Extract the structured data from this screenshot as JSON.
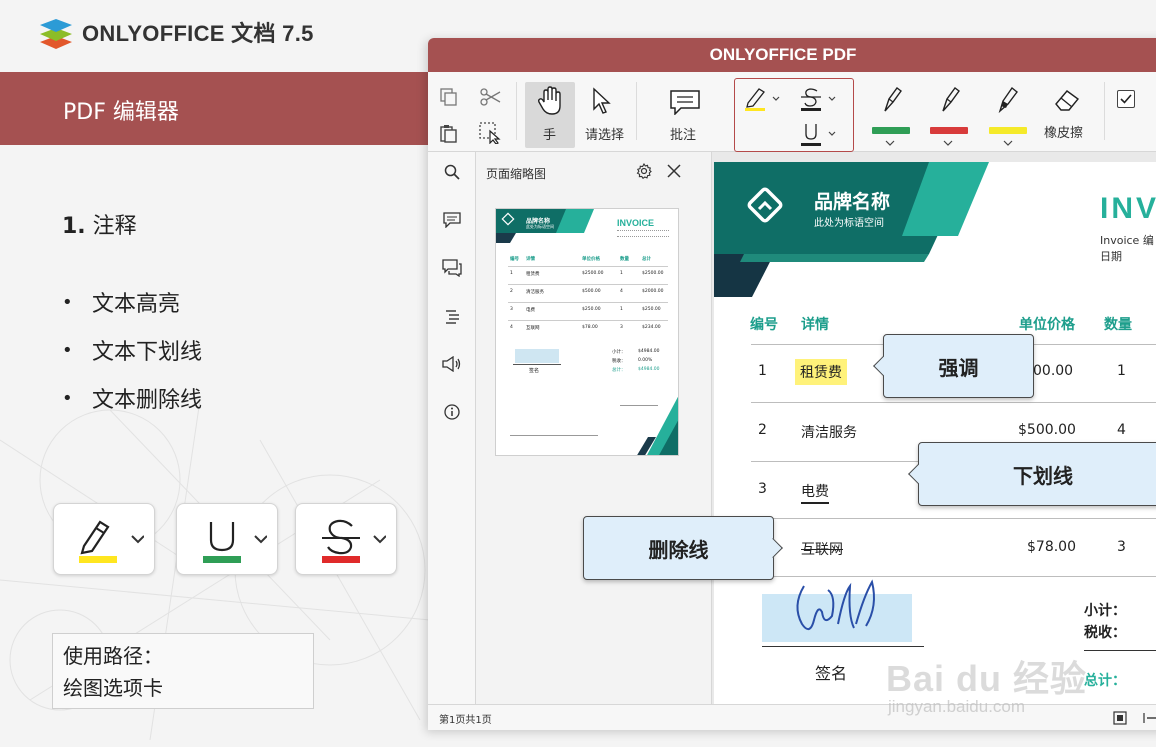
{
  "brand": {
    "name": "ONLYOFFICE 文档 7.5"
  },
  "slide": {
    "banner": "PDF 编辑器",
    "section_num": "1.",
    "section_title": "注释",
    "bullets": [
      "文本高亮",
      "文本下划线",
      "文本删除线"
    ],
    "path_line1": "使用路径：",
    "path_line2": "绘图选项卡",
    "colors": {
      "highlight": "#ffe620",
      "underline": "#2f9e56",
      "strike": "#e02a2a"
    }
  },
  "app": {
    "title": "ONLYOFFICE PDF",
    "toolbar": {
      "hand": "手",
      "select": "请选择",
      "comment": "批注",
      "eraser": "橡皮擦"
    },
    "pen_colors": [
      "#2f9e56",
      "#d83b3b",
      "#f5ea2a"
    ],
    "thumbs_title": "页面缩略图",
    "status": "第1页共1页"
  },
  "invoice": {
    "brand_name": "品牌名称",
    "brand_sub": "此处为标语空间",
    "title": "INV",
    "invoice_label": "Invoice 编",
    "date_label": "日期",
    "headers": {
      "num": "编号",
      "detail": "详情",
      "unit_price": "单位价格",
      "qty": "数量"
    },
    "rows": [
      {
        "num": "1",
        "detail": "租赁费",
        "price": "00.00",
        "qty": "1"
      },
      {
        "num": "2",
        "detail": "清洁服务",
        "price": "$500.00",
        "qty": "4"
      },
      {
        "num": "3",
        "detail": "电费",
        "price": "",
        "qty": ""
      },
      {
        "num": "",
        "detail": "互联网",
        "price": "$78.00",
        "qty": "3"
      }
    ],
    "signature_label": "签名",
    "subtotal": "小计：",
    "tax": "税收：",
    "total": "总计："
  },
  "thumb_invoice": {
    "brand": "品牌名称",
    "sub": "此处为标语空间",
    "title": "INVOICE",
    "headers": [
      "编号",
      "详情",
      "单位价格",
      "数量",
      "总计"
    ],
    "rows": [
      [
        "1",
        "租赁费",
        "$2500.00",
        "1",
        "$2500.00"
      ],
      [
        "2",
        "清洁服务",
        "$500.00",
        "4",
        "$2000.00"
      ],
      [
        "3",
        "电费",
        "$250.00",
        "1",
        "$250.00"
      ],
      [
        "4",
        "互联网",
        "$78.00",
        "3",
        "$234.00"
      ]
    ],
    "sum_labels": [
      "小计：",
      "税收：",
      "总计："
    ],
    "sum_values": [
      "$4984.00",
      "0.00%",
      "$4984.00"
    ],
    "sign": "签名"
  },
  "callouts": {
    "emphasis": "强调",
    "underline": "下划线",
    "strikethrough": "删除线"
  },
  "watermark": {
    "main": "Bai du 经验",
    "sub": "jingyan.baidu.com"
  }
}
